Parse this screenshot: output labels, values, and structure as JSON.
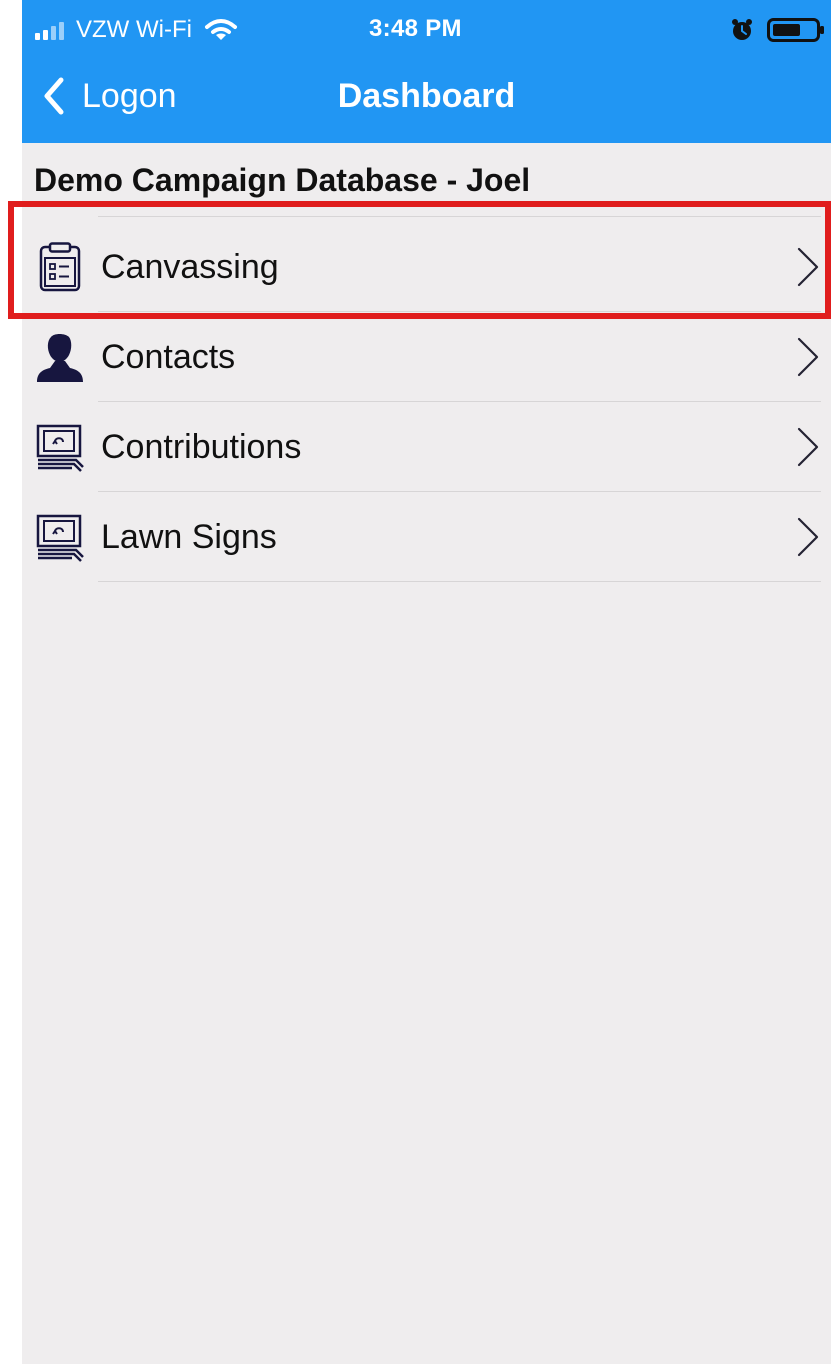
{
  "status_bar": {
    "carrier": "VZW Wi-Fi",
    "time": "3:48 PM",
    "icons": [
      "signal-icon",
      "wifi-icon",
      "alarm-icon",
      "battery-icon"
    ]
  },
  "navigation": {
    "back_label": "Logon",
    "title": "Dashboard"
  },
  "section": {
    "title": "Demo Campaign Database - Joel"
  },
  "menu": {
    "items": [
      {
        "label": "Canvassing",
        "icon": "clipboard-icon"
      },
      {
        "label": "Contacts",
        "icon": "person-icon"
      },
      {
        "label": "Contributions",
        "icon": "money-icon"
      },
      {
        "label": "Lawn Signs",
        "icon": "money-icon"
      }
    ]
  },
  "colors": {
    "nav_background": "#2196f3",
    "screen_background": "#efedee",
    "icon": "#17163f",
    "highlight": "#e01d1d",
    "chevron": "#242333"
  }
}
